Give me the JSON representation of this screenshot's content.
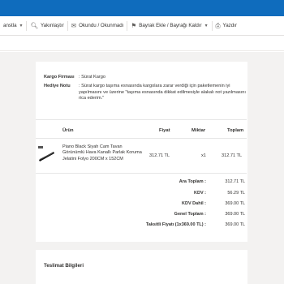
{
  "toolbar": {
    "items": [
      {
        "label": "anstla",
        "icon": "reply-all-icon"
      },
      {
        "label": "Yakınlaştır",
        "icon": "zoom-icon"
      },
      {
        "label": "Okundu / Okunmadı",
        "icon": "envelope-open-icon"
      },
      {
        "label": "Bayrak Ekle / Bayrağı Kaldır",
        "icon": "flag-icon"
      },
      {
        "label": "Yazdır",
        "icon": "printer-icon"
      }
    ]
  },
  "order": {
    "cargo_label": "Kargo Firması",
    "cargo_value": ": Sürat Kargo",
    "gift_label": "Hediye Notu",
    "gift_value": ": Sürat kargo taşıma esnasında kargolara zarar verdiği için paketlemenin iyi yapılmasını ve üzerine \"taşıma esnasında dikkat edilmesiyle alakalı not yazılmasını rica ederim.\"",
    "columns": {
      "product": "Ürün",
      "price": "Fiyat",
      "qty": "Miktar",
      "total": "Toplam"
    },
    "items": [
      {
        "name": "Piano Black Siyah Cam Tavan Görünümlü Hava Kanallı Parlak Koruma Jelatini Folyo 200CM x 152CM",
        "price": "312.71 TL",
        "qty": "x1",
        "total": "312.71 TL"
      }
    ],
    "summary": [
      {
        "label": "Ara Toplam :",
        "value": "312.71 TL"
      },
      {
        "label": "KDV :",
        "value": "56.29 TL"
      },
      {
        "label": "KDV Dahil :",
        "value": "369.00 TL"
      },
      {
        "label": "Genel Toplam :",
        "value": "369.00 TL"
      },
      {
        "label": "Taksitli Fiyatı (1x369.00 TL) :",
        "value": "369.00 TL"
      }
    ]
  },
  "shipping": {
    "title": "Teslimat Bilgileri"
  },
  "colors": {
    "brand": "#0f6cbd",
    "background": "#f3f2f1"
  }
}
